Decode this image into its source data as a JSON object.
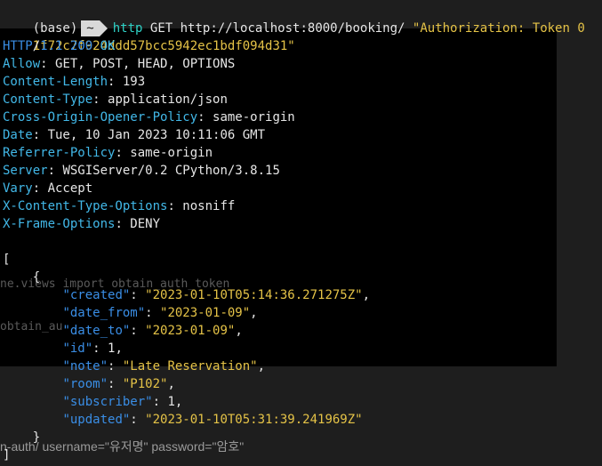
{
  "prompt": {
    "env": "(base)",
    "dir": "~",
    "command": "http",
    "args": "GET http://localhost:8000/booking/",
    "auth_header_part1": "\"Authorization: Token 0",
    "auth_header_part2": "1f72c7f924ddd57bcc5942ec1bdf094d31\""
  },
  "status": {
    "proto": "HTTP",
    "slash": "/",
    "version": "1.1",
    "code": "200",
    "text": "OK"
  },
  "headers": [
    {
      "name": "Allow",
      "value": "GET, POST, HEAD, OPTIONS"
    },
    {
      "name": "Content-Length",
      "value": "193"
    },
    {
      "name": "Content-Type",
      "value": "application/json"
    },
    {
      "name": "Cross-Origin-Opener-Policy",
      "value": "same-origin"
    },
    {
      "name": "Date",
      "value": "Tue, 10 Jan 2023 10:11:06 GMT"
    },
    {
      "name": "Referrer-Policy",
      "value": "same-origin"
    },
    {
      "name": "Server",
      "value": "WSGIServer/0.2 CPython/3.8.15"
    },
    {
      "name": "Vary",
      "value": "Accept"
    },
    {
      "name": "X-Content-Type-Options",
      "value": "nosniff"
    },
    {
      "name": "X-Frame-Options",
      "value": "DENY"
    }
  ],
  "body": {
    "open_bracket": "[",
    "open_brace": "{",
    "close_brace": "}",
    "close_bracket": "]",
    "fields": [
      {
        "key": "\"created\"",
        "value": "\"2023-01-10T05:14:36.271275Z\"",
        "comma": ",",
        "type": "string"
      },
      {
        "key": "\"date_from\"",
        "value": "\"2023-01-09\"",
        "comma": ",",
        "type": "string"
      },
      {
        "key": "\"date_to\"",
        "value": "\"2023-01-09\"",
        "comma": ",",
        "type": "string"
      },
      {
        "key": "\"id\"",
        "value": "1",
        "comma": ",",
        "type": "number"
      },
      {
        "key": "\"note\"",
        "value": "\"Late Reservation\"",
        "comma": ",",
        "type": "string"
      },
      {
        "key": "\"room\"",
        "value": "\"P102\"",
        "comma": ",",
        "type": "string"
      },
      {
        "key": "\"subscriber\"",
        "value": "1",
        "comma": ",",
        "type": "number"
      },
      {
        "key": "\"updated\"",
        "value": "\"2023-01-10T05:31:39.241969Z\"",
        "comma": "",
        "type": "string"
      }
    ]
  },
  "background_text": {
    "ghost1": "ne.views import obtain_auth_token",
    "ghost2": "obtain_au",
    "ghost3": "n-auth/ username=\"유저명\" password=\"암호\""
  }
}
